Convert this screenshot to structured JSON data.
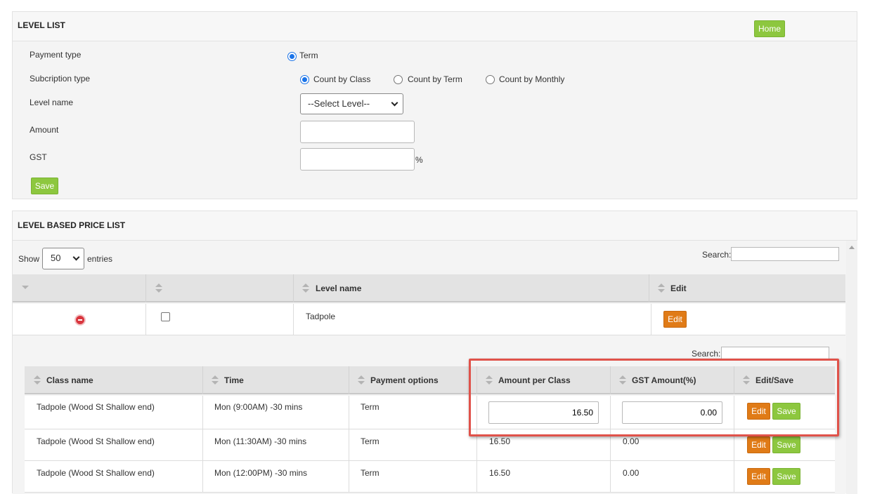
{
  "level_list": {
    "title": "LEVEL LIST",
    "home_label": "Home",
    "payment_type_label": "Payment type",
    "payment_type_option": "Term",
    "subscription_type_label": "Subcription type",
    "subscription_options": [
      "Count by Class",
      "Count by Term",
      "Count by Monthly"
    ],
    "subscription_selected": "Count by Class",
    "level_name_label": "Level name",
    "level_select_value": "--Select Level--",
    "amount_label": "Amount",
    "amount_value": "",
    "gst_label": "GST",
    "gst_value": "",
    "gst_unit": "%",
    "save_label": "Save"
  },
  "price_list": {
    "title": "LEVEL BASED PRICE LIST",
    "show_label": "Show",
    "entries_value": "50",
    "entries_label": "entries",
    "search_label": "Search:",
    "columns": [
      "",
      "",
      "Level name",
      "Edit"
    ],
    "row": {
      "level_name": "Tadpole",
      "edit_label": "Edit"
    },
    "sub_table": {
      "search_label": "Search:",
      "columns": [
        "Class name",
        "Time",
        "Payment options",
        "Amount per Class",
        "GST Amount(%)",
        "Edit/Save"
      ],
      "rows": [
        {
          "class_name": "Tadpole (Wood St Shallow end)",
          "time": "Mon (9:00AM) -30 mins",
          "payment": "Term",
          "amount": "16.50",
          "gst": "0.00",
          "edit": "Edit",
          "save": "Save"
        },
        {
          "class_name": "Tadpole (Wood St Shallow end)",
          "time": "Mon (11:30AM) -30 mins",
          "payment": "Term",
          "amount": "16.50",
          "gst": "0.00",
          "edit": "Edit",
          "save": "Save"
        },
        {
          "class_name": "Tadpole (Wood St Shallow end)",
          "time": "Mon (12:00PM) -30 mins",
          "payment": "Term",
          "amount": "16.50",
          "gst": "0.00",
          "edit": "Edit",
          "save": "Save"
        }
      ]
    }
  },
  "colors": {
    "green": "#8dc73f",
    "orange": "#e07b17",
    "highlight": "#e0524a",
    "radio_blue": "#1a73e8"
  }
}
